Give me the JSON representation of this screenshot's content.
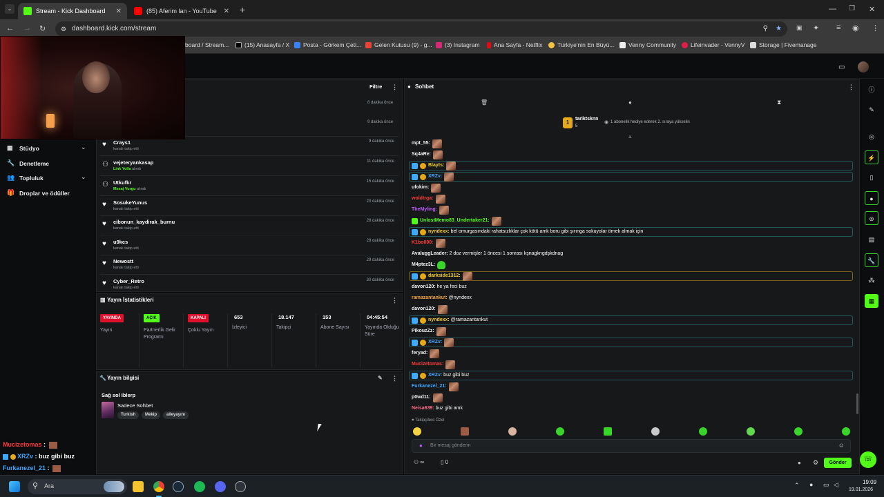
{
  "browser": {
    "tabs": [
      {
        "title": "Stream - Kick Dashboard",
        "active": true
      },
      {
        "title": "(85) Aferim lan - YouTube",
        "active": false
      }
    ],
    "url": "dashboard.kick.com/stream",
    "bookmarks": [
      "board / Stream...",
      "(15) Anasayfa / X",
      "Posta - Görkem Çeti...",
      "Gelen Kutusu (9) - g...",
      "(3) Instagram",
      "Ana Sayfa - Netflix",
      "Türkiye'nin En Büyü...",
      "Venny Community",
      "Lifeinvader - VennyV",
      "Storage | Fivemanage"
    ]
  },
  "sidebar": {
    "items": [
      {
        "label": "Stüdyo",
        "icon": "grid-icon",
        "chevron": true
      },
      {
        "label": "Denetleme",
        "icon": "wrench-icon",
        "chevron": false
      },
      {
        "label": "Topluluk",
        "icon": "users-icon",
        "chevron": true
      },
      {
        "label": "Droplar ve ödüller",
        "icon": "gift-icon",
        "chevron": false
      }
    ]
  },
  "activity": {
    "filter_label": "Filtre",
    "partial_times": [
      "8 dakika önce",
      "9 dakika önce"
    ],
    "rows": [
      {
        "name": "Crays1",
        "sub": "kanalı takip etti",
        "time": "9 dakika önce",
        "icon": "heart"
      },
      {
        "name": "vejeteryankasap",
        "sub_highlight": "Link Yolla",
        "sub": "alındı",
        "time": "11 dakika önce",
        "icon": "reward"
      },
      {
        "name": "Utkufkr",
        "sub_highlight": "Mesaj Vurgu",
        "sub": "alındı",
        "time": "15 dakika önce",
        "icon": "reward"
      },
      {
        "name": "SosukeYunus",
        "sub": "kanalı takip etti",
        "time": "20 dakika önce",
        "icon": "heart"
      },
      {
        "name": "cibonun_kaydirak_burnu",
        "sub": "kanalı takip etti",
        "time": "28 dakika önce",
        "icon": "heart"
      },
      {
        "name": "u9kcs",
        "sub": "kanalı takip etti",
        "time": "28 dakika önce",
        "icon": "heart"
      },
      {
        "name": "Newostt",
        "sub": "kanalı takip etti",
        "time": "29 dakika önce",
        "icon": "heart"
      },
      {
        "name": "Cyber_Retro",
        "sub": "kanalı takip etti",
        "time": "30 dakika önce",
        "icon": "heart"
      }
    ]
  },
  "stats": {
    "title": "Yayın İstatistikleri",
    "columns": [
      {
        "badge": "YAYINDA",
        "badge_color": "#e0102c",
        "label": "Yayın"
      },
      {
        "badge": "AÇIK",
        "badge_color": "#53fc18",
        "label": "Partnerlik Gelir Programı"
      },
      {
        "badge": "KAPALI",
        "badge_color": "#e0102c",
        "label": "Çoklu Yayın"
      },
      {
        "value": "653",
        "label": "İzleyici"
      },
      {
        "value": "18.147",
        "label": "Takipçi"
      },
      {
        "value": "153",
        "label": "Abone Sayısı"
      },
      {
        "value": "04:45:54",
        "label": "Yayında Olduğu Süre"
      }
    ]
  },
  "stream_info": {
    "title": "Yayın bilgisi",
    "stream_title": "Sağ sol Iblerp",
    "category": "Sadece Sohbet",
    "tags": [
      "Turkish",
      "Mekip",
      "aileyayını"
    ]
  },
  "chat": {
    "title": "Sohbet",
    "pinned_user": "tariktsknn",
    "pinned_rank": "1",
    "pinned_sub": "5",
    "pinned_text": "1 abonelik hediye ederek 2. sıraya yükselin",
    "messages": [
      {
        "user": "mpt_55:",
        "color": "#f2f2f2",
        "text": "",
        "emote": true
      },
      {
        "user": "Sq4aRe:",
        "color": "#f2f2f2",
        "text": "",
        "emote": true
      },
      {
        "user": "Blayts:",
        "color": "#f2d022",
        "text": "",
        "emote": true,
        "hl": "teal",
        "badges": true
      },
      {
        "user": "XRZv:",
        "color": "#3da9ff",
        "text": "",
        "emote": true,
        "hl": "teal",
        "badges": true
      },
      {
        "user": "ufokim:",
        "color": "#f2f2f2",
        "text": "",
        "emote": true
      },
      {
        "user": "woldtrga:",
        "color": "#ff3b3b",
        "text": "",
        "emote": true
      },
      {
        "user": "TheMyling:",
        "color": "#c15cff",
        "text": "",
        "emote": true
      },
      {
        "user": "UnlostMemo83_Undertaker21:",
        "color": "#53fc18",
        "text": "",
        "emote": true,
        "greenbadge": true
      },
      {
        "user": "nyndexx:",
        "color": "#f2d022",
        "text": " bel omurgasındaki rahatsızlıklar çok kötü amk boru gibi şırınga sokuyolar örnek almak için",
        "hl": "teal",
        "badges": true
      },
      {
        "user": "K1bo000:",
        "color": "#ff3b3b",
        "text": "",
        "emote": true
      },
      {
        "user": "AvaluggLeader:",
        "color": "#f2f2f2",
        "text": " 2 doz vermişler 1 öncesi 1 sonrası kşnagkngdşkdnag"
      },
      {
        "user": "M4ptez3L:",
        "color": "#f2f2f2",
        "text": "",
        "green": true
      },
      {
        "user": "darkside1312:",
        "color": "#f2d022",
        "text": "",
        "emote": true,
        "hl": "gold",
        "badges": true
      },
      {
        "user": "davon120:",
        "color": "#f2f2f2",
        "text": " he ya feci buz"
      },
      {
        "user": "ramazantankut:",
        "color": "#f2a23a",
        "text": " @nyndexx"
      },
      {
        "user": "davon120:",
        "color": "#f2f2f2",
        "text": "",
        "emote": true
      },
      {
        "user": "nyndexx:",
        "color": "#f2d022",
        "text": " @ramazantankut",
        "hl": "teal",
        "badges": true
      },
      {
        "user": "PikouzZz:",
        "color": "#f2f2f2",
        "text": "",
        "emote": true
      },
      {
        "user": "XRZv:",
        "color": "#3da9ff",
        "text": "",
        "emote": true,
        "hl": "teal",
        "badges": true
      },
      {
        "user": "feryad:",
        "color": "#f2f2f2",
        "text": "",
        "emote": true
      },
      {
        "user": "Mucizetomas:",
        "color": "#ff3b3b",
        "text": "",
        "emote": true
      },
      {
        "user": "XRZv:",
        "color": "#3da9ff",
        "text": " buz gibi buz",
        "hl": "teal",
        "badges": true
      },
      {
        "user": "Furkanezel_21:",
        "color": "#3da9ff",
        "text": "",
        "emote": true
      },
      {
        "user": "p0wd11:",
        "color": "#f2f2f2",
        "text": "",
        "emote": true
      },
      {
        "user": "Neisa639:",
        "color": "#ff6b8b",
        "text": " buz gibi amk"
      }
    ],
    "followers_only_label": "Takipçilere Özel",
    "input_placeholder": "Bir mesaj gönderin",
    "send_label": "Gönder",
    "points_value": "0",
    "infinity": "∞"
  },
  "overlay": {
    "lines": [
      {
        "user": "Mucizetomas",
        "text": " :",
        "color": "#ff3b3b"
      },
      {
        "user": "XRZv",
        "text": " : buz gibi buz",
        "color": "#3da9ff"
      },
      {
        "user": "Furkanezel_21",
        "text": " :",
        "color": "#3da9ff"
      },
      {
        "user": "p0wd11",
        "text": " :",
        "color": "#f2d022"
      }
    ]
  },
  "taskbar": {
    "search_placeholder": "Ara",
    "time": "19:09",
    "date": "19.01.2026"
  }
}
